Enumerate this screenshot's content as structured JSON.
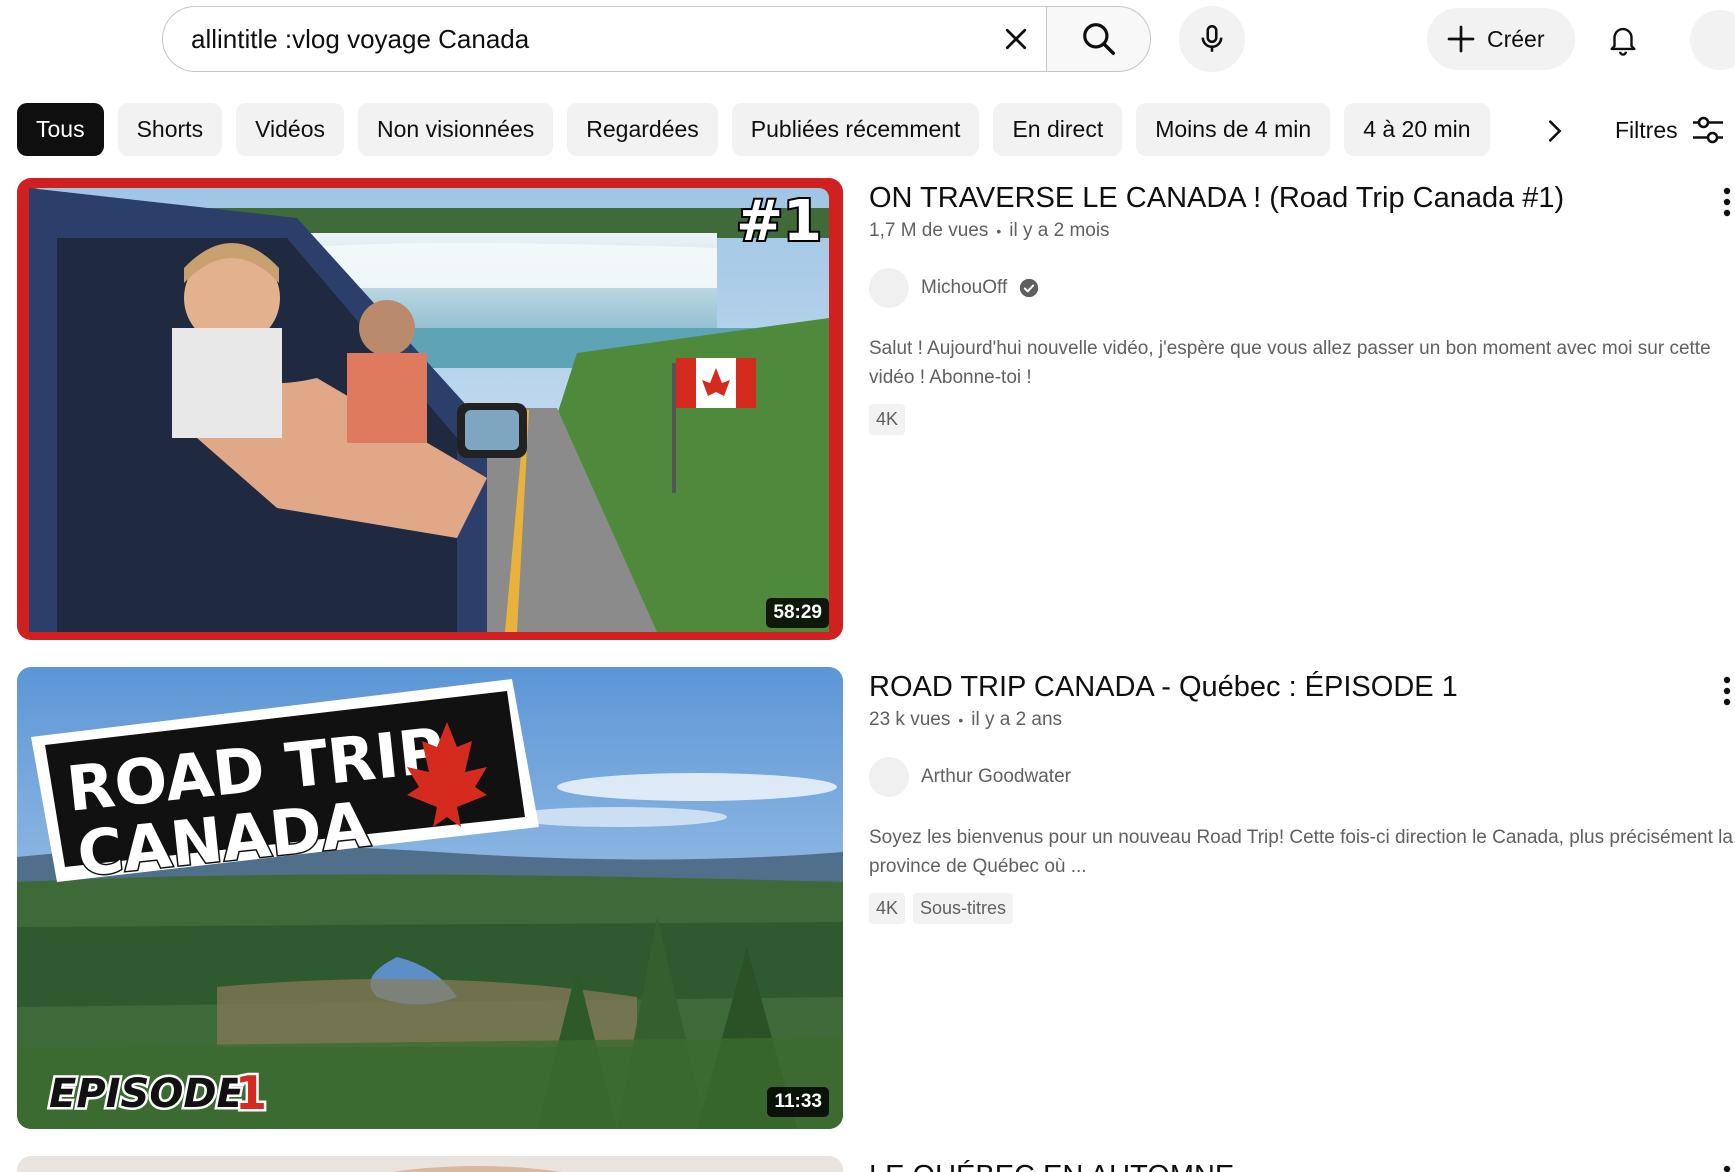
{
  "search": {
    "query": "allintitle :vlog voyage Canada"
  },
  "header": {
    "create_label": "Créer"
  },
  "chips": [
    {
      "label": "Tous",
      "active": true
    },
    {
      "label": "Shorts"
    },
    {
      "label": "Vidéos"
    },
    {
      "label": "Non visionnées"
    },
    {
      "label": "Regardées"
    },
    {
      "label": "Publiées récemment"
    },
    {
      "label": "En direct"
    },
    {
      "label": "Moins de 4 min"
    },
    {
      "label": "4 à 20 min"
    }
  ],
  "filters_label": "Filtres",
  "results": [
    {
      "title": "ON TRAVERSE LE CANADA ! (Road Trip Canada #1)",
      "views": "1,7 M de vues",
      "age": "il y a 2 mois",
      "channel": "MichouOff",
      "verified": true,
      "description": "Salut ! Aujourd'hui nouvelle vidéo, j'espère que vous allez passer un bon moment avec moi sur cette vidéo ! Abonne-toi !",
      "badges": [
        "4K"
      ],
      "duration": "58:29",
      "thumb_overlay": "#1"
    },
    {
      "title": "ROAD TRIP CANADA - Québec : ÉPISODE 1",
      "views": "23 k vues",
      "age": "il y a 2 ans",
      "channel": "Arthur Goodwater",
      "verified": false,
      "description": "Soyez les bienvenus pour un nouveau Road Trip! Cette fois-ci direction le Canada, plus précisément la province de Québec où ...",
      "badges": [
        "4K",
        "Sous-titres"
      ],
      "duration": "11:33",
      "thumb_overlay_line1": "ROAD TRIP",
      "thumb_overlay_line2": "CANADA",
      "thumb_overlay_episode": "EPISODE",
      "thumb_overlay_episode_num": "1"
    },
    {
      "title": "LE QUÉBEC EN AUTOMNE"
    }
  ]
}
